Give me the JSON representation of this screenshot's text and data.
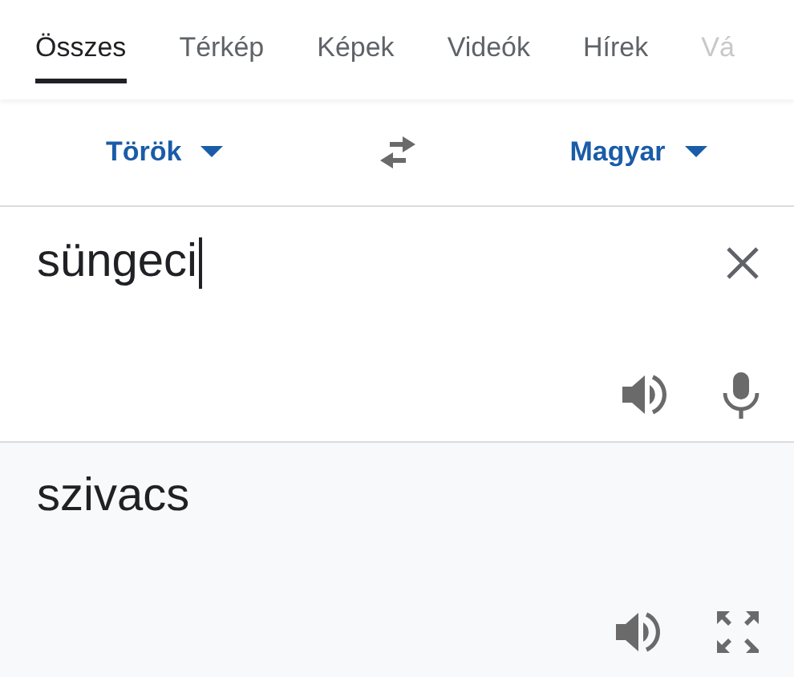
{
  "tabs": [
    {
      "label": "Összes",
      "selected": true,
      "faded": false
    },
    {
      "label": "Térkép",
      "selected": false,
      "faded": false
    },
    {
      "label": "Képek",
      "selected": false,
      "faded": false
    },
    {
      "label": "Videók",
      "selected": false,
      "faded": false
    },
    {
      "label": "Hírek",
      "selected": false,
      "faded": false
    },
    {
      "label": "Vá",
      "selected": false,
      "faded": true
    }
  ],
  "languages": {
    "source": "Török",
    "target": "Magyar"
  },
  "input": {
    "value": "süngeci"
  },
  "output": {
    "text": "szivacs"
  }
}
